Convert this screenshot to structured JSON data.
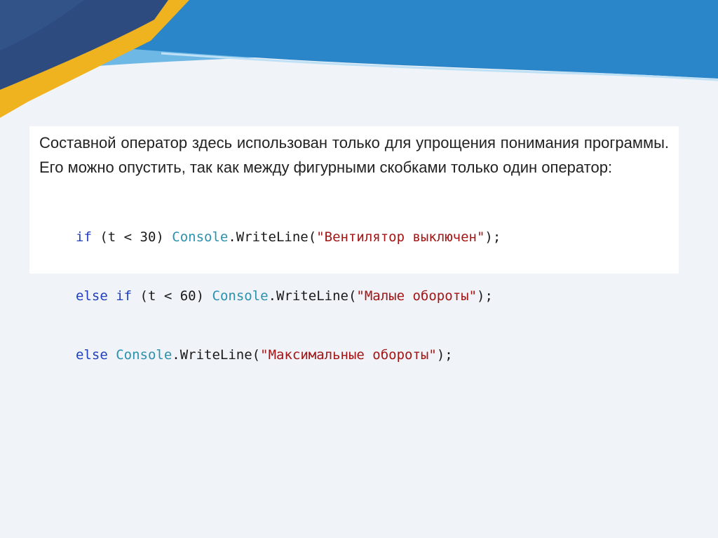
{
  "slide": {
    "colors": {
      "background": "#f0f3f7",
      "dark_navy": "#2d4b7e",
      "blue": "#2a86c8",
      "light_blue": "#5fb0e3",
      "yellow": "#f0b320"
    },
    "paragraph": "Составной оператор здесь использован только для упрощения понимания программы. Его можно опустить, так как между фигурными скобками только один оператор:",
    "code": {
      "colors": {
        "keyword": "#1f3fbf",
        "type": "#2b91af",
        "string": "#a31515",
        "plain": "#1a1a1a"
      },
      "line1": {
        "kw_if": "if",
        "cond": " (t < 30) ",
        "type": "Console",
        "call": ".WriteLine(",
        "str": "\"Вентилятор выключен\"",
        "end": ");"
      },
      "line2": {
        "kw_else": "else",
        "space": " ",
        "kw_if": "if",
        "cond": " (t < 60) ",
        "type": "Console",
        "call": ".WriteLine(",
        "str": "\"Малые обороты\"",
        "end": ");"
      },
      "line3": {
        "kw_else": "else",
        "space": " ",
        "type": "Console",
        "call": ".WriteLine(",
        "str": "\"Максимальные обороты\"",
        "end": ");"
      }
    }
  }
}
